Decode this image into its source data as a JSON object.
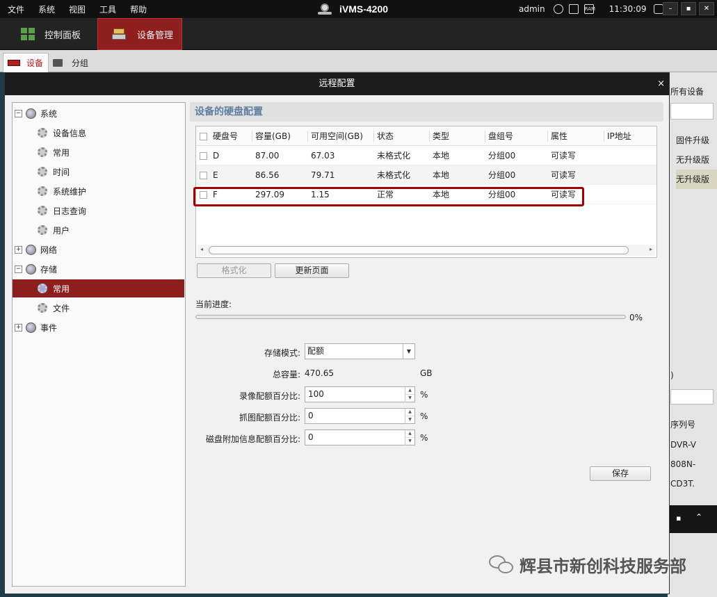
{
  "menubar": {
    "items": [
      "文件",
      "系统",
      "视图",
      "工具",
      "帮助"
    ],
    "app_title": "iVMS-4200",
    "user": "admin",
    "clock": "11:30:09",
    "ram_label": "RAM"
  },
  "toolbar": {
    "dashboard": "控制面板",
    "device_mgmt": "设备管理"
  },
  "subtabs": {
    "device": "设备",
    "group": "分组"
  },
  "background_panel": {
    "header": "所有设备",
    "col": "固件升级",
    "row1": "无升级版",
    "row2": "无升级版",
    "misc": ")",
    "serial_header": "序列号",
    "s1": "DVR-V",
    "s2": "808N-",
    "s3": "CD3T."
  },
  "dialog": {
    "title": "远程配置",
    "close": "×"
  },
  "tree": {
    "system": "系统",
    "device_info": "设备信息",
    "general": "常用",
    "time": "时间",
    "maintenance": "系统维护",
    "log_query": "日志查询",
    "user": "用户",
    "network": "网络",
    "storage": "存储",
    "storage_general": "常用",
    "file": "文件",
    "event": "事件"
  },
  "main": {
    "section_title": "设备的硬盘配置",
    "columns": [
      "硬盘号",
      "容量(GB)",
      "可用空间(GB)",
      "状态",
      "类型",
      "盘组号",
      "属性",
      "IP地址"
    ],
    "rows": [
      {
        "disk": "D",
        "capacity": "87.00",
        "free": "67.03",
        "status": "未格式化",
        "type": "本地",
        "group": "分组00",
        "attr": "可读写"
      },
      {
        "disk": "E",
        "capacity": "86.56",
        "free": "79.71",
        "status": "未格式化",
        "type": "本地",
        "group": "分组00",
        "attr": "可读写"
      },
      {
        "disk": "F",
        "capacity": "297.09",
        "free": "1.15",
        "status": "正常",
        "type": "本地",
        "group": "分组00",
        "attr": "可读写"
      }
    ],
    "format_btn": "格式化",
    "refresh_btn": "更新页面",
    "progress_label": "当前进度:",
    "progress_value": "0%",
    "progress_fraction": 0,
    "storage_mode_label": "存储模式:",
    "storage_mode_value": "配额",
    "total_capacity_label": "总容量:",
    "total_capacity_value": "470.65",
    "total_capacity_unit": "GB",
    "record_quota_label": "录像配额百分比:",
    "record_quota_value": "100",
    "snapshot_quota_label": "抓图配额百分比:",
    "snapshot_quota_value": "0",
    "extra_quota_label": "磁盘附加信息配额百分比:",
    "extra_quota_value": "0",
    "percent": "%",
    "save_btn": "保存"
  },
  "watermark": "辉县市新创科技服务部",
  "colors": {
    "accent_red": "#8d1e1e",
    "highlight_box": "#a40000",
    "title_blue": "#5f7ea0"
  }
}
